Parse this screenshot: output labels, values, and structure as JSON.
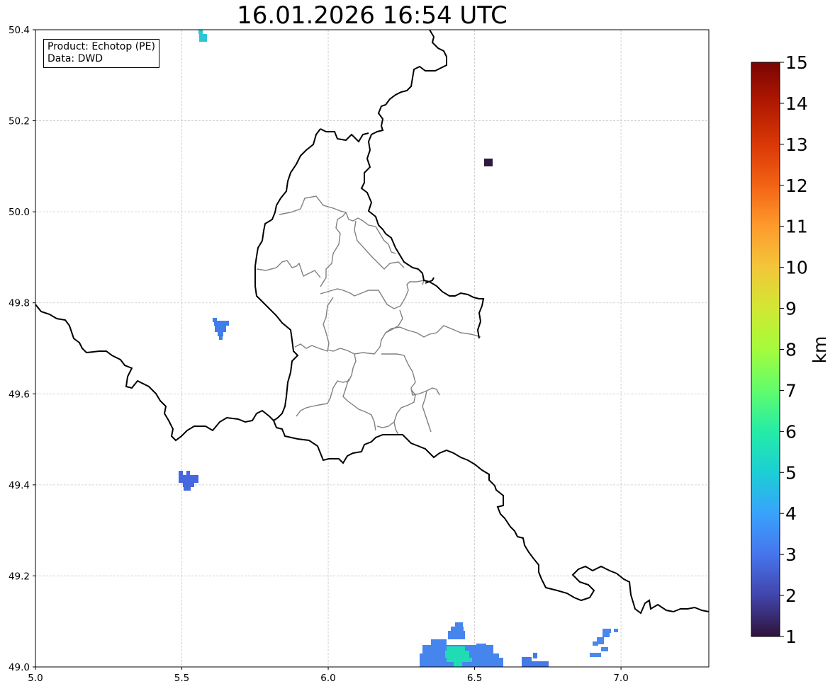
{
  "title": "16.01.2026 16:54 UTC",
  "info": {
    "product": "Product: Echotop (PE)",
    "data_source": "Data: DWD"
  },
  "map": {
    "lon_range": [
      5.0,
      7.3
    ],
    "lat_range": [
      49.0,
      50.4
    ],
    "x_ticks": [
      "5.0",
      "5.5",
      "6.0",
      "6.5",
      "7.0"
    ],
    "y_ticks": [
      "49.0",
      "49.2",
      "49.4",
      "49.6",
      "49.8",
      "50.0",
      "50.2",
      "50.4"
    ],
    "grid": true,
    "colors": {
      "national_border": "#000000",
      "canton_border": "#808080",
      "grid": "#c8c8c8"
    }
  },
  "colorbar": {
    "unit": "km",
    "range": [
      1,
      15
    ],
    "ticks": [
      "1",
      "2",
      "3",
      "4",
      "5",
      "6",
      "7",
      "8",
      "9",
      "10",
      "11",
      "12",
      "13",
      "14",
      "15"
    ],
    "colormap": "turbo",
    "colors": [
      "#30123b",
      "#4145ab",
      "#4675ed",
      "#39a2fc",
      "#1bcfd4",
      "#24eca6",
      "#61fc6c",
      "#a4fc3b",
      "#d1e834",
      "#f3c63a",
      "#fe9b2d",
      "#f36315",
      "#d93806",
      "#b11901",
      "#7a0402"
    ]
  },
  "radar_echoes": [
    {
      "lon": 5.57,
      "lat": 50.385,
      "value_km": 4.6
    },
    {
      "lon": 5.63,
      "lat": 49.745,
      "value_km": 3.7
    },
    {
      "lon": 5.52,
      "lat": 49.41,
      "value_km": 3.2
    },
    {
      "lon": 6.55,
      "lat": 50.11,
      "value_km": 1.4
    },
    {
      "lon": 6.4,
      "lat": 49.03,
      "value_km": 3.4
    },
    {
      "lon": 6.43,
      "lat": 49.03,
      "value_km": 5.6
    },
    {
      "lon": 6.7,
      "lat": 49.015,
      "value_km": 3.3
    },
    {
      "lon": 6.93,
      "lat": 49.05,
      "value_km": 3.5
    }
  ]
}
